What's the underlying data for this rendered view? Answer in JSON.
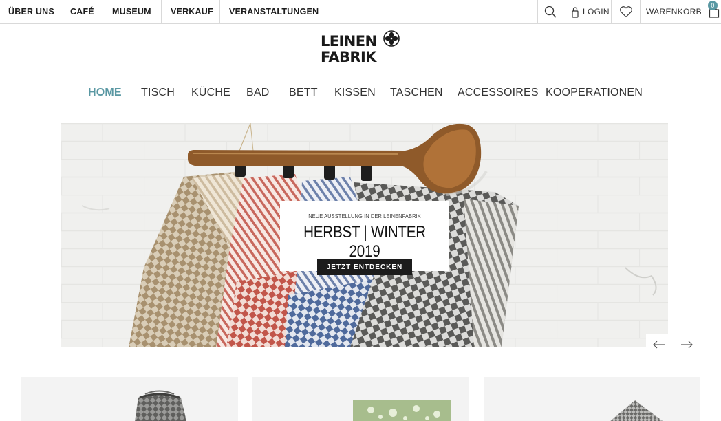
{
  "top_nav": {
    "items": [
      "ÜBER UNS",
      "CAFÉ",
      "MUSEUM",
      "VERKAUF",
      "VERANSTALTUNGEN"
    ]
  },
  "utility": {
    "search_icon": "search-icon",
    "login_label": "LOGIN",
    "login_icon": "lock-icon",
    "wishlist_icon": "heart-icon",
    "cart_label": "WARENKORB",
    "cart_icon": "shopping-bag-icon",
    "cart_count": "0"
  },
  "logo": {
    "line1": "LEINEN",
    "line2": "FABRIK"
  },
  "main_nav": {
    "items": [
      "HOME",
      "TISCH",
      "KÜCHE",
      "BAD",
      "BETT",
      "KISSEN",
      "TASCHEN",
      "ACCESSOIRES",
      "KOOPERATIONEN"
    ],
    "active": "HOME"
  },
  "hero": {
    "eyebrow": "NEUE AUSSTELLUNG IN DER LEINENFABRIK",
    "title": "HERBST | WINTER 2019",
    "cta_label": "JETZT ENTDECKEN",
    "prev_icon": "arrow-left-icon",
    "next_icon": "arrow-right-icon"
  },
  "colors": {
    "accent": "#5a98a3",
    "cta_background": "#1c1c1c",
    "tile_background": "#f3f3f3"
  }
}
